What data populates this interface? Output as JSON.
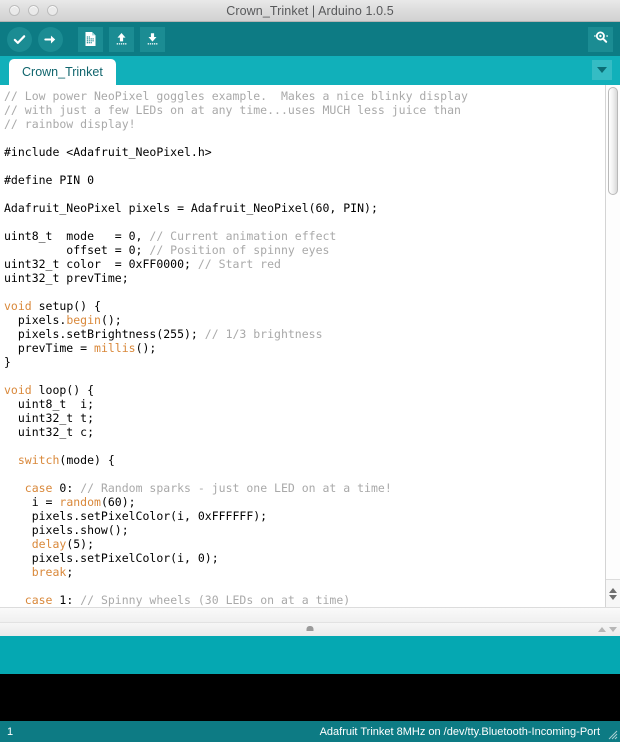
{
  "window": {
    "title": "Crown_Trinket | Arduino 1.0.5",
    "traffic_lights": [
      "close-button",
      "minimize-button",
      "zoom-button"
    ]
  },
  "toolbar": {
    "verify_label": "Verify",
    "upload_label": "Upload",
    "new_label": "New",
    "open_label": "Open",
    "save_label": "Save",
    "serial_monitor_label": "Serial Monitor"
  },
  "tabs": {
    "items": [
      {
        "label": "Crown_Trinket",
        "active": true
      }
    ],
    "menu_label": "Tab Menu"
  },
  "editor": {
    "code_lines": [
      {
        "text": "// Low power NeoPixel goggles example.  Makes a nice blinky display",
        "type": "comment"
      },
      {
        "text": "// with just a few LEDs on at any time...uses MUCH less juice than",
        "type": "comment"
      },
      {
        "text": "// rainbow display!",
        "type": "comment"
      },
      {
        "text": "",
        "type": "blank"
      },
      {
        "text": "#include <Adafruit_NeoPixel.h>",
        "type": "plain"
      },
      {
        "text": "",
        "type": "blank"
      },
      {
        "text": "#define PIN 0",
        "type": "plain"
      },
      {
        "text": "",
        "type": "blank"
      },
      {
        "text": "Adafruit_NeoPixel pixels = Adafruit_NeoPixel(60, PIN);",
        "type": "plain"
      },
      {
        "text": "",
        "type": "blank"
      },
      {
        "text": "uint8_t  mode   = 0, // Current animation effect",
        "type": "mixed"
      },
      {
        "text": "         offset = 0; // Position of spinny eyes",
        "type": "mixed"
      },
      {
        "text": "uint32_t color  = 0xFF0000; // Start red",
        "type": "mixed"
      },
      {
        "text": "uint32_t prevTime;",
        "type": "plain"
      },
      {
        "text": "",
        "type": "blank"
      },
      {
        "text": "void setup() {",
        "type": "mixed"
      },
      {
        "text": "  pixels.begin();",
        "type": "mixed"
      },
      {
        "text": "  pixels.setBrightness(255); // 1/3 brightness",
        "type": "mixed"
      },
      {
        "text": "  prevTime = millis();",
        "type": "mixed"
      },
      {
        "text": "}",
        "type": "plain"
      },
      {
        "text": "",
        "type": "blank"
      },
      {
        "text": "void loop() {",
        "type": "mixed"
      },
      {
        "text": "  uint8_t  i;",
        "type": "plain"
      },
      {
        "text": "  uint32_t t;",
        "type": "plain"
      },
      {
        "text": "  uint32_t c;",
        "type": "plain"
      },
      {
        "text": "",
        "type": "blank"
      },
      {
        "text": "  switch(mode) {",
        "type": "mixed"
      },
      {
        "text": "",
        "type": "blank"
      },
      {
        "text": "   case 0: // Random sparks - just one LED on at a time!",
        "type": "mixed"
      },
      {
        "text": "    i = random(60);",
        "type": "mixed"
      },
      {
        "text": "    pixels.setPixelColor(i, 0xFFFFFF);",
        "type": "plain"
      },
      {
        "text": "    pixels.show();",
        "type": "plain"
      },
      {
        "text": "    delay(5);",
        "type": "mixed"
      },
      {
        "text": "    pixels.setPixelColor(i, 0);",
        "type": "plain"
      },
      {
        "text": "    break;",
        "type": "mixed"
      },
      {
        "text": "",
        "type": "blank"
      },
      {
        "text": "   case 1: // Spinny wheels (30 LEDs on at a time)",
        "type": "mixed"
      }
    ],
    "colors": {
      "comment": "#a9a9a9",
      "keyword": "#d9883a",
      "function": "#e0a040",
      "text": "#000000",
      "background": "#ffffff"
    }
  },
  "console": {
    "text": ""
  },
  "message_bar": {
    "text": ""
  },
  "statusbar": {
    "line_number": "1",
    "board_info": "Adafruit Trinket 8MHz on /dev/tty.Bluetooth-Incoming-Port"
  },
  "theme": {
    "toolbar_teal": "#0d7b84",
    "tabbar_teal": "#11b0ba",
    "message_teal": "#05a8b2",
    "status_teal": "#0d7b84",
    "tab_text": "#10656d"
  }
}
